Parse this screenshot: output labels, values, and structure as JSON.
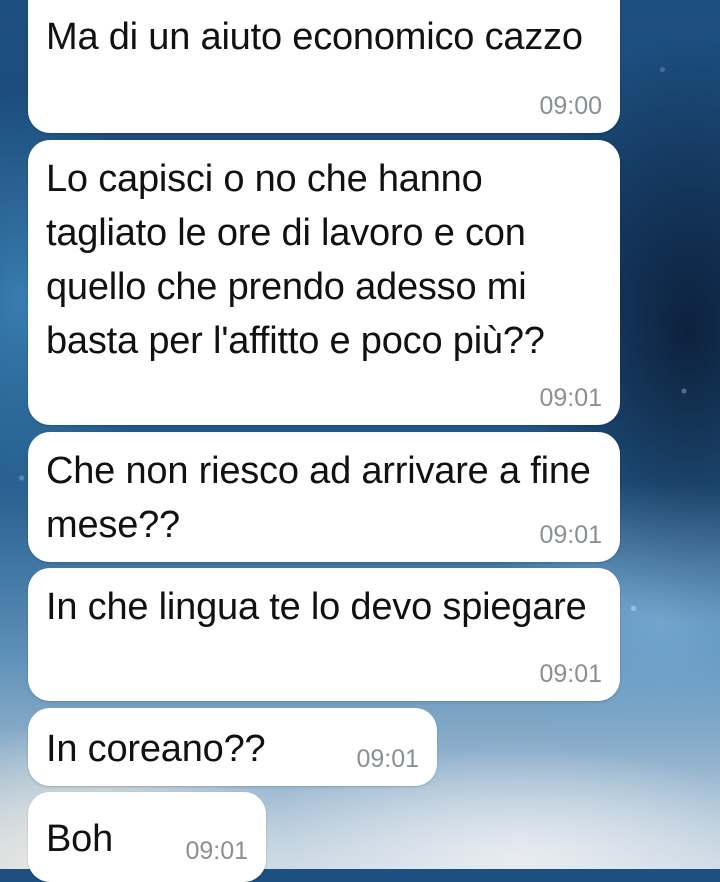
{
  "messages": [
    {
      "text": "Ma di un aiuto economico cazzo",
      "time": "09:00"
    },
    {
      "text": "Lo capisci o no che hanno tagliato le ore di lavoro e con quello che prendo adesso mi basta per l'affitto e poco più??",
      "time": "09:01"
    },
    {
      "text": "Che non riesco ad arrivare a fine mese??",
      "time": "09:01"
    },
    {
      "text": "In che lingua te lo devo spiegare",
      "time": "09:01"
    },
    {
      "text": "In coreano??",
      "time": "09:01"
    },
    {
      "text": "Boh",
      "time": "09:01"
    }
  ],
  "colors": {
    "bubble_background": "#ffffff",
    "message_text": "#111111",
    "timestamp_text": "#8a8f94",
    "wallpaper_primary": "#1d4f7f"
  }
}
